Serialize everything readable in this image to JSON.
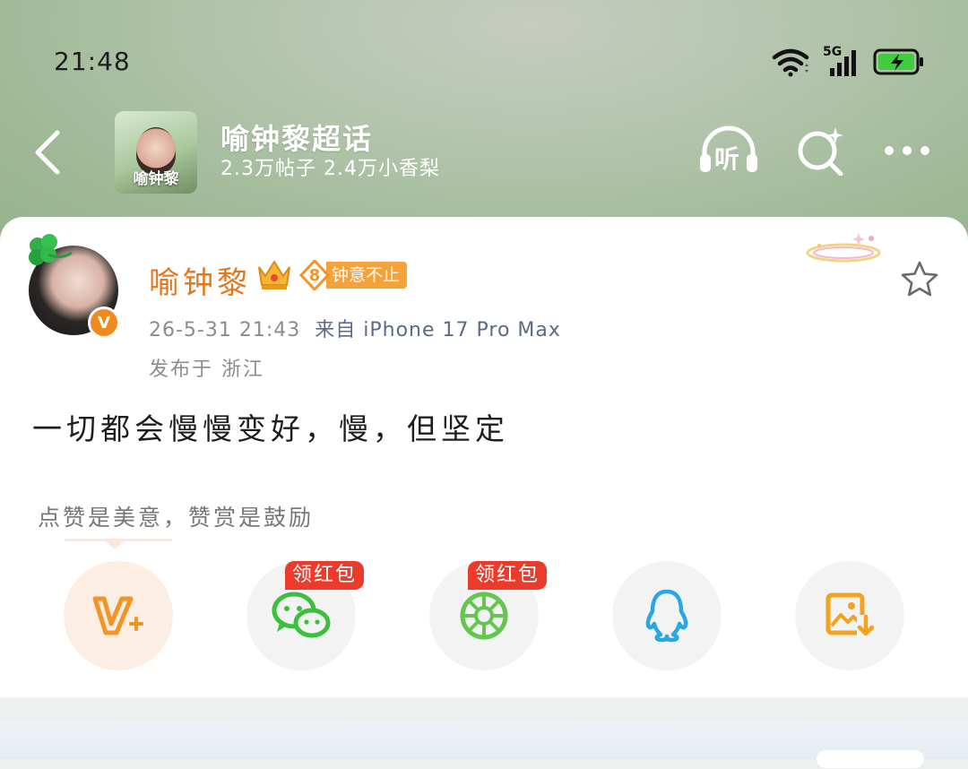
{
  "status_bar": {
    "time": "21:48",
    "network": "5G",
    "icons": [
      "wifi-icon",
      "signal-icon",
      "battery-charging-icon"
    ],
    "battery_color": "#3fcc3f"
  },
  "header": {
    "back_icon": "chevron-left-icon",
    "thumb_label": "喻钟黎",
    "title": "喻钟黎超话",
    "subtitle": "2.3万帖子 2.4万小香梨",
    "listen_label": "听",
    "search_icon": "search-sparkle-icon",
    "more_icon": "more-dots-icon"
  },
  "post": {
    "author": {
      "name": "喻钟黎",
      "verified_label": "V",
      "fan_badge_level": "8",
      "fan_badge_text": "钟意不止"
    },
    "time": "26-5-31 21:43",
    "source": "来自 iPhone 17 Pro Max",
    "location": "发布于 浙江",
    "content": "一切都会慢慢变好，慢，但坚定",
    "reward_tip": "点赞是美意，赞赏是鼓励",
    "favorite_icon": "star-outline-icon"
  },
  "share": {
    "buttons": [
      {
        "name": "v-plus",
        "icon": "v-plus-icon",
        "color": "#f29427"
      },
      {
        "name": "wechat",
        "icon": "wechat-icon",
        "color": "#3cbf3c",
        "tag": "领红包"
      },
      {
        "name": "moments",
        "icon": "moments-icon",
        "color": "#63c74d",
        "tag": "领红包"
      },
      {
        "name": "qq",
        "icon": "qq-icon",
        "color": "#29a7e1"
      },
      {
        "name": "save-image",
        "icon": "save-image-icon",
        "color": "#f2a21c"
      }
    ]
  },
  "colors": {
    "accent_orange": "#e2781e",
    "header_green": "#a3bb9a",
    "red_tag": "#ec3a2b"
  }
}
